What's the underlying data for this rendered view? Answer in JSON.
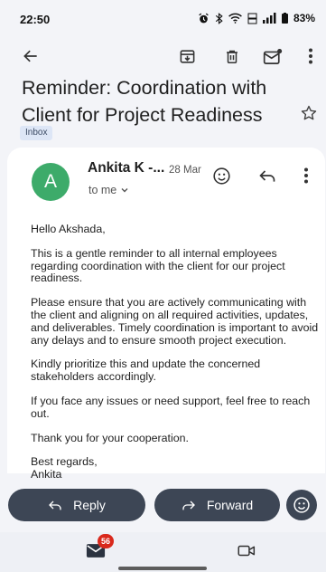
{
  "status_bar": {
    "time": "22:50",
    "battery": "83%",
    "icons": [
      "alarm-icon",
      "bluetooth-icon",
      "wifi-icon",
      "volte-icon",
      "signal-icon",
      "battery-icon"
    ]
  },
  "app_bar": {
    "icons": [
      "back-arrow-icon",
      "archive-icon",
      "delete-icon",
      "mark-unread-icon",
      "more-vert-icon"
    ]
  },
  "email": {
    "subject": "Reminder: Coordination with Client for Project Readiness",
    "label": "Inbox",
    "sender": "Ankita K -...",
    "date": "28 Mar",
    "recipient": "to me",
    "body": {
      "greeting": "Hello Akshada,",
      "p1": "This is a gentle reminder to all internal employees regarding coordination with the client for our project readiness.",
      "p2": "Please ensure that you are actively communicating with the client and aligning on all required activities, updates, and deliverables. Timely coordination is important to avoid any delays and to ensure smooth project execution.",
      "p3": "Kindly prioritize this and update the concerned stakeholders accordingly.",
      "p4": "If you face any issues or need support, feel free to reach out.",
      "p5": "Thank you for your cooperation.",
      "closing": "Best regards,",
      "signature": "Ankita"
    }
  },
  "actions": {
    "reply": "Reply",
    "forward": "Forward"
  },
  "bottom_nav": {
    "mail_badge": "56",
    "items": [
      "mail-icon",
      "meet-video-icon"
    ]
  },
  "colors": {
    "avatar": "#3dab6a",
    "action_pill": "#3d4655",
    "badge": "#d9291c",
    "label_chip": "#dde6f6"
  }
}
